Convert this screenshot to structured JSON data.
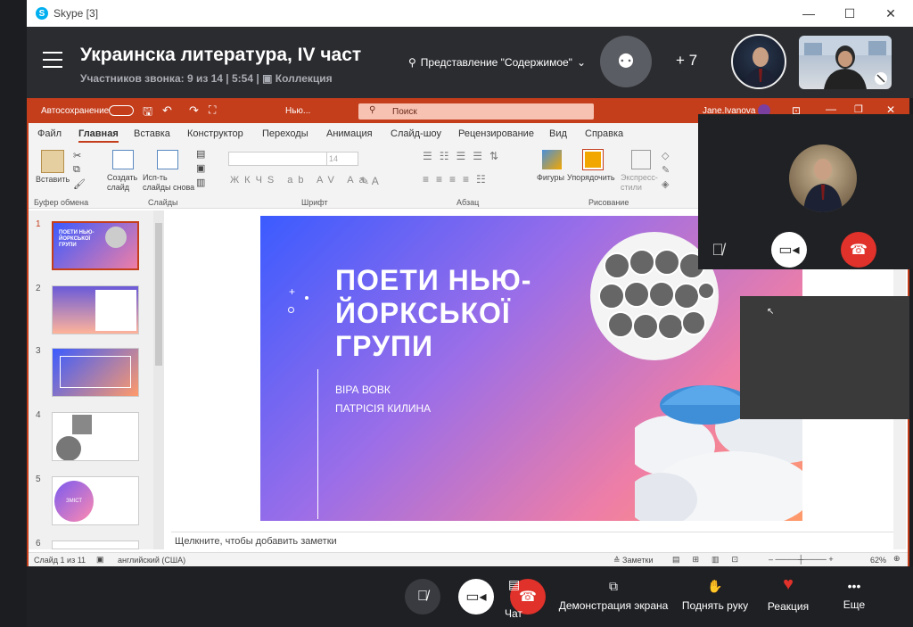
{
  "window": {
    "title": "Skype [3]"
  },
  "call": {
    "title": "Украинска литература, IV част",
    "subtitle": "Участников звонка: 9 из 14 | 5:54",
    "collection": "Коллекция",
    "view_mode": "Представление \"Содержимое\"",
    "more_count": "+ 7"
  },
  "ppt": {
    "autosave": "Автосохранение",
    "filename": "Нью...",
    "search_placeholder": "Поиск",
    "user": "Jane.Ivanova",
    "tabs": [
      "Файл",
      "Главная",
      "Вставка",
      "Конструктор",
      "Переходы",
      "Анимация",
      "Слайд-шоу",
      "Рецензирование",
      "Вид",
      "Справка"
    ],
    "ribbon": {
      "paste": "Вставить",
      "create_slide": "Создать слайд",
      "reuse_slides": "Исп-ть слайды снова",
      "clipboard": "Буфер обмена",
      "slides": "Слайды",
      "font_size": "14",
      "font": "Шрифт",
      "paragraph": "Абзац",
      "shapes": "Фигуры",
      "arrange": "Упорядочить",
      "express_styles": "Экспресс-стили",
      "drawing": "Рисование"
    },
    "slide_numbers": [
      "1",
      "2",
      "3",
      "4",
      "5",
      "6"
    ],
    "thumb1_title": "ПОЕТИ НЬЮ-ЙОРКСЬКОЇ ГРУПИ",
    "thumb5_label": "ЗМІСТ",
    "slide": {
      "title": "ПОЕТИ НЬЮ-ЙОРКСЬКОЇ ГРУПИ",
      "author1": "ВІРА ВОВК",
      "author2": "ПАТРІСІЯ КИЛИНА"
    },
    "notes_placeholder": "Щелкните, чтобы добавить заметки",
    "status": {
      "slide_of": "Слайд 1 из 11",
      "language": "английский (США)",
      "notes": "Заметки",
      "zoom": "62%"
    }
  },
  "controls": {
    "chat": "Чат",
    "share": "Демонстрация экрана",
    "raise_hand": "Поднять руку",
    "reaction": "Реакция",
    "more": "Еще"
  },
  "colors": {
    "accent": "#c43e1c",
    "end_call": "#e0312a",
    "skype": "#00aff0"
  }
}
